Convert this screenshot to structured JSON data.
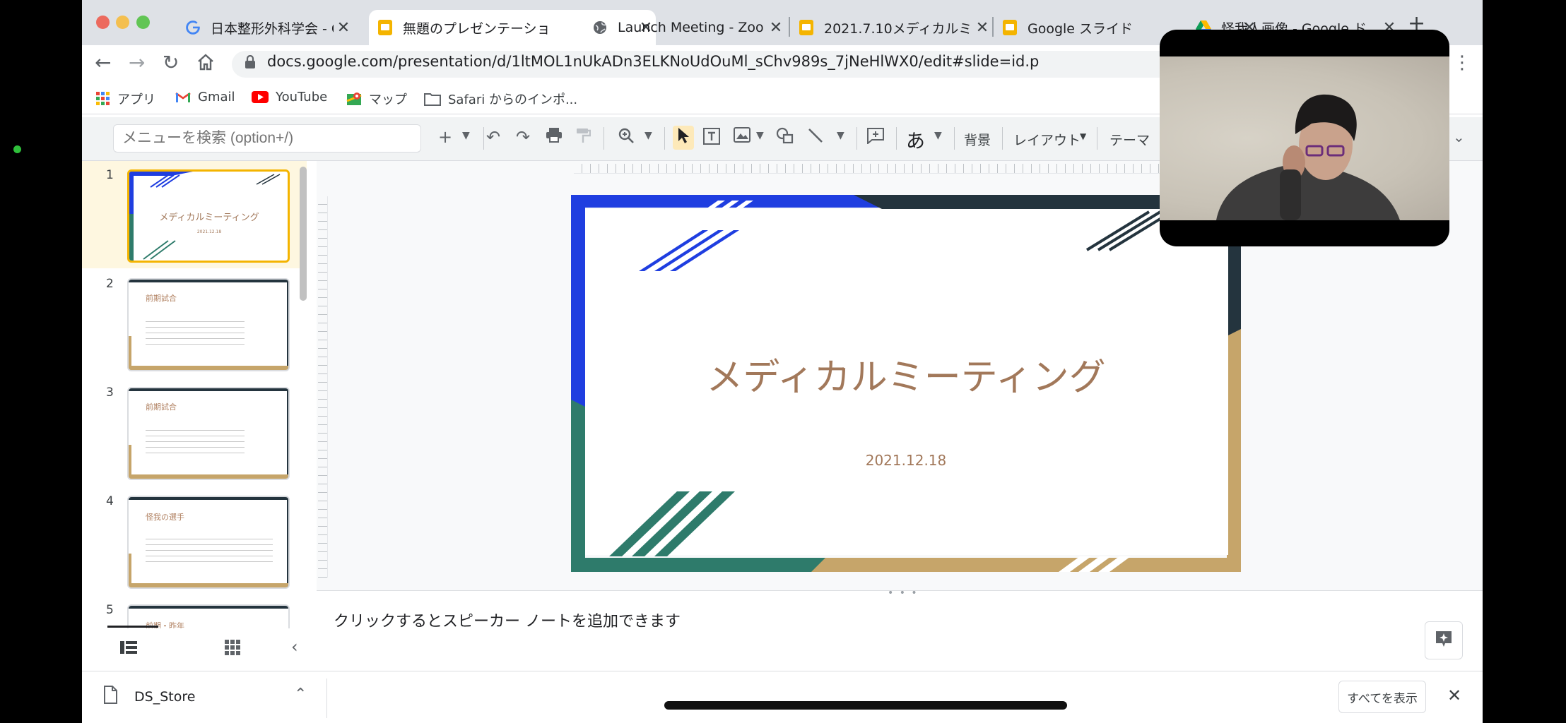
{
  "tabs": [
    {
      "title": "日本整形外科学会 - Goo",
      "icon": "google-g-icon",
      "active": false
    },
    {
      "title": "無題のプレゼンテーショ",
      "icon": "slides-icon",
      "active": true
    },
    {
      "title": "Launch Meeting - Zoo",
      "icon": "globe-icon",
      "active": false
    },
    {
      "title": "2021.7.10メディカルミ",
      "icon": "slides-icon",
      "active": false
    },
    {
      "title": "Google スライド",
      "icon": "slides-icon",
      "active": false
    },
    {
      "title": "怪我人画像 - Google ド",
      "icon": "drive-icon",
      "active": false
    }
  ],
  "address": {
    "url": "docs.google.com/presentation/d/1ltMOL1nUkADn3ELKNoUdOuMl_sChv989s_7jNeHlWX0/edit#slide=id.p"
  },
  "bookmarks": [
    {
      "label": "アプリ",
      "icon": "apps-grid-icon"
    },
    {
      "label": "Gmail",
      "icon": "gmail-icon"
    },
    {
      "label": "YouTube",
      "icon": "youtube-icon"
    },
    {
      "label": "マップ",
      "icon": "maps-icon"
    },
    {
      "label": "Safari からのインポ...",
      "icon": "folder-icon"
    }
  ],
  "toolbar": {
    "search_placeholder": "メニューを検索 (option+/)",
    "input_tool": "あ",
    "background": "背景",
    "layout": "レイアウト",
    "theme": "テーマ"
  },
  "filmstrip": {
    "slides": [
      {
        "number": "1",
        "title": "メディカルミーティング",
        "subtitle": "2021.12.18"
      },
      {
        "number": "2",
        "title": "前期試合"
      },
      {
        "number": "3",
        "title": "前期試合"
      },
      {
        "number": "4",
        "title": "怪我の選手"
      },
      {
        "number": "5",
        "title": "前期・昨年"
      }
    ]
  },
  "slide": {
    "title": "メディカルミーティング",
    "date": "2021.12.18",
    "colors": {
      "blue": "#1f3ee0",
      "teal": "#2e7b6b",
      "gold": "#c6a56a",
      "navy": "#24343e",
      "text": "#a2785a"
    }
  },
  "notes": {
    "placeholder": "クリックするとスピーカー ノートを追加できます"
  },
  "download_shelf": {
    "file": "DS_Store",
    "show_all": "すべてを表示"
  }
}
